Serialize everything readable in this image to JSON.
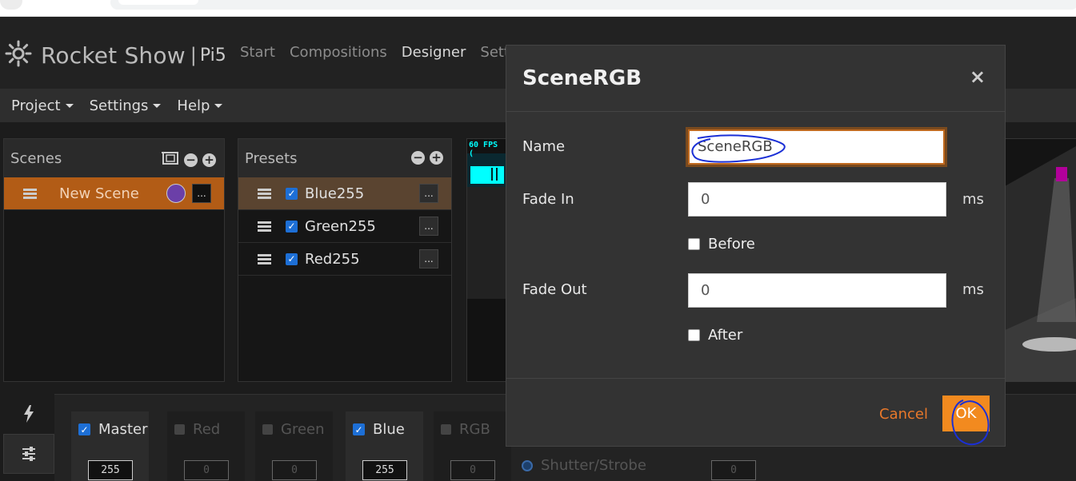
{
  "app": {
    "brand_name": "Rocket Show",
    "brand_separator": "|",
    "brand_host": "Pi5",
    "nav": [
      "Start",
      "Compositions",
      "Designer",
      "Settin"
    ],
    "active_nav": "Designer"
  },
  "menubar": {
    "items": [
      "Project",
      "Settings",
      "Help"
    ]
  },
  "scenes_panel": {
    "title": "Scenes",
    "items": [
      {
        "label": "New Scene",
        "selected": true,
        "menu": "..."
      }
    ]
  },
  "presets_panel": {
    "title": "Presets",
    "items": [
      {
        "label": "Blue255",
        "checked": true,
        "menu": "..."
      },
      {
        "label": "Green255",
        "checked": true,
        "menu": "..."
      },
      {
        "label": "Red255",
        "checked": true,
        "menu": "..."
      }
    ]
  },
  "preview": {
    "fps_text": "60 FPS ("
  },
  "channels": [
    {
      "label": "Master",
      "enabled": true,
      "value": "255"
    },
    {
      "label": "Red",
      "enabled": false,
      "value": "0"
    },
    {
      "label": "Green",
      "enabled": false,
      "value": "0"
    },
    {
      "label": "Blue",
      "enabled": true,
      "value": "255"
    },
    {
      "label": "RGB",
      "enabled": false,
      "value": "0"
    }
  ],
  "strobe": {
    "label": "Shutter/Strobe",
    "value": "0"
  },
  "modal": {
    "title": "SceneRGB",
    "close": "×",
    "name_label": "Name",
    "name_value": "SceneRGB",
    "fade_in_label": "Fade In",
    "fade_in_value": "0",
    "fade_in_unit": "ms",
    "before_label": "Before",
    "fade_out_label": "Fade Out",
    "fade_out_value": "0",
    "fade_out_unit": "ms",
    "after_label": "After",
    "cancel_label": "Cancel",
    "ok_label": "OK"
  },
  "colors": {
    "accent": "#f28a1f",
    "selected_row": "#b25c16",
    "checkbox": "#1d6fd6",
    "scene_color": "#6b3fa8",
    "annotation": "#1a2fd6"
  }
}
